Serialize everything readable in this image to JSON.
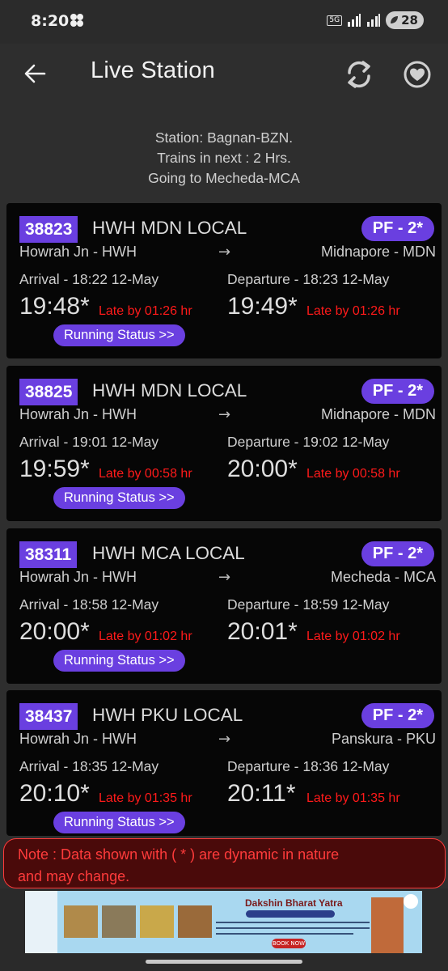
{
  "status_bar": {
    "time": "8:20",
    "network": "5G",
    "battery": "28"
  },
  "header": {
    "title": "Live Station"
  },
  "info": {
    "station": "Station: Bagnan-BZN.",
    "window": "Trains in next : 2 Hrs.",
    "direction": "Going to Mecheda-MCA"
  },
  "trains": [
    {
      "number": "38823",
      "name": "HWH MDN LOCAL",
      "platform": "PF - 2*",
      "from": "Howrah Jn - HWH",
      "arrow": "→",
      "to": "Midnapore - MDN",
      "arrival": "Arrival -  18:22 12-May",
      "departure": "Departure -  18:23 12-May",
      "actual_arrival": "19:48*",
      "actual_departure": "19:49*",
      "arrival_late": "Late by 01:26 hr",
      "departure_late": "Late by 01:26 hr",
      "running_status": "Running Status >>"
    },
    {
      "number": "38825",
      "name": "HWH MDN LOCAL",
      "platform": "PF - 2*",
      "from": "Howrah Jn - HWH",
      "arrow": "→",
      "to": "Midnapore - MDN",
      "arrival": "Arrival -  19:01 12-May",
      "departure": "Departure -  19:02 12-May",
      "actual_arrival": "19:59*",
      "actual_departure": "20:00*",
      "arrival_late": "Late by 00:58 hr",
      "departure_late": "Late by 00:58 hr",
      "running_status": "Running Status >>"
    },
    {
      "number": "38311",
      "name": "HWH MCA LOCAL",
      "platform": "PF - 2*",
      "from": "Howrah Jn - HWH",
      "arrow": "→",
      "to": "Mecheda - MCA",
      "arrival": "Arrival -  18:58 12-May",
      "departure": "Departure -  18:59 12-May",
      "actual_arrival": "20:00*",
      "actual_departure": "20:01*",
      "arrival_late": "Late by 01:02 hr",
      "departure_late": "Late by 01:02 hr",
      "running_status": "Running Status >>"
    },
    {
      "number": "38437",
      "name": "HWH PKU LOCAL",
      "platform": "PF - 2*",
      "from": "Howrah Jn - HWH",
      "arrow": "→",
      "to": "Panskura - PKU",
      "arrival": "Arrival -  18:35 12-May",
      "departure": "Departure -  18:36 12-May",
      "actual_arrival": "20:10*",
      "actual_departure": "20:11*",
      "arrival_late": "Late by 01:35 hr",
      "departure_late": "Late by 01:35 hr",
      "running_status": "Running Status >>"
    }
  ],
  "note": {
    "line1": "Note : Data shown with ( * ) are dynamic in nature",
    "line2": "and may change."
  },
  "ad": {
    "title": "Dakshin Bharat Yatra",
    "button": "BOOK NOW"
  },
  "colors": {
    "accent": "#6a3fe0",
    "late": "#ff1a1a",
    "card_bg": "#060606",
    "page_bg": "#2e2e2e"
  },
  "icons": [
    "back-arrow-icon",
    "refresh-icon",
    "heart-icon"
  ]
}
